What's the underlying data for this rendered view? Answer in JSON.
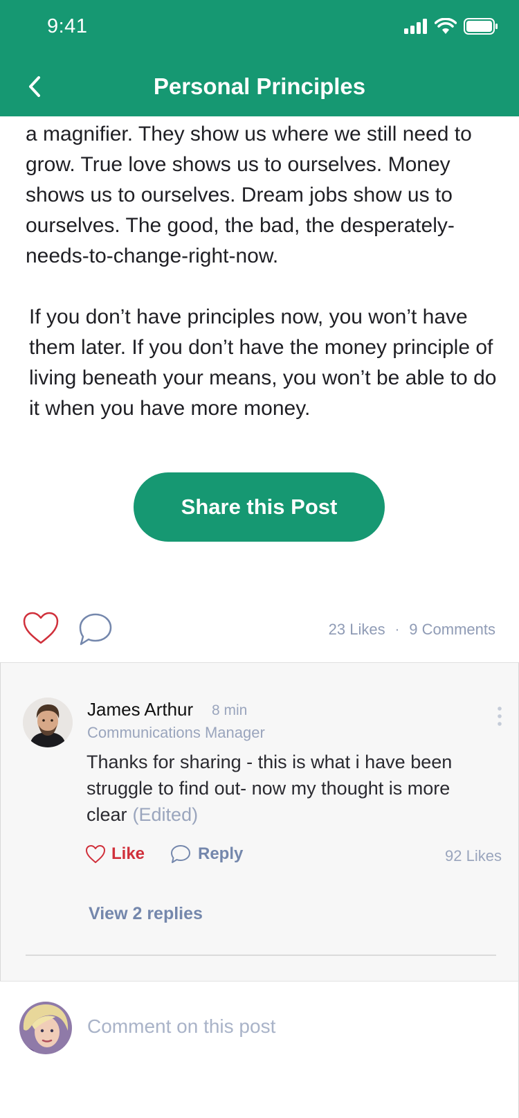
{
  "status_bar": {
    "time": "9:41"
  },
  "header": {
    "title": "Personal Principles"
  },
  "article": {
    "paragraph1": "a magnifier. They show us where we still need to grow. True love shows us to ourselves. Money shows us to ourselves. Dream jobs show us to ourselves. The good, the bad, the desperately-needs-to-change-right-now.",
    "paragraph2": "If you don’t have principles now, you won’t have them later. If you don’t have the money principle of living beneath your means, you won’t be able to do it when you have more money."
  },
  "share_button": {
    "label": "Share this Post"
  },
  "post_stats": {
    "likes": "23 Likes",
    "separator": "·",
    "comments": "9 Comments"
  },
  "comment": {
    "name": "James Arthur",
    "time": "8 min",
    "role": "Communications Manager",
    "text": "Thanks for sharing - this is what i have been struggle to find out- now my thought is more clear",
    "edited": "(Edited)",
    "like_label": "Like",
    "reply_label": "Reply",
    "likes": "92 Likes",
    "view_replies": "View 2 replies"
  },
  "composer": {
    "placeholder": "Comment on this post"
  },
  "colors": {
    "brand": "#169872",
    "like_red": "#d0303b",
    "muted": "#9aa5bd",
    "link_blue": "#7487ac"
  }
}
